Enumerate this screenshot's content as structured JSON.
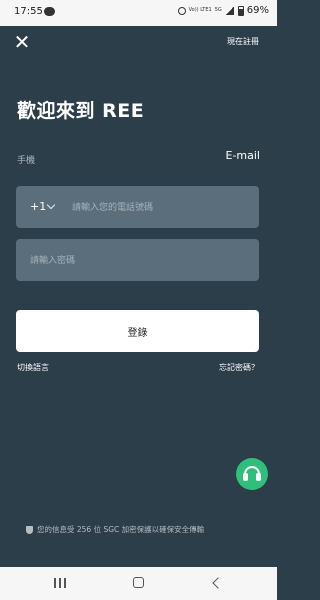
{
  "status_bar": {
    "time": "17:55",
    "network": "Vo)) LTE1",
    "signal_label": "5G",
    "battery": "69%"
  },
  "header": {
    "close_label": "✕",
    "register_label": "現在註冊"
  },
  "title": "歡迎來到 REE",
  "tabs": {
    "phone": "手機",
    "email": "E-mail"
  },
  "form": {
    "country_code": "+1",
    "phone_placeholder": "請輸入您的電話號碼",
    "password_placeholder": "請輸入密碼",
    "login_label": "登錄"
  },
  "links": {
    "switch_language": "切換語言",
    "forgot_password": "忘記密碼？"
  },
  "security_note": "您的信息受 256 位 SGC 加密保護以確保安全傳輸",
  "colors": {
    "background": "#2d3e4b",
    "field": "#5a6e7b",
    "support": "#2ec07a"
  },
  "icons": [
    "close-icon",
    "chevron-down-icon",
    "headset-icon",
    "shield-icon"
  ]
}
